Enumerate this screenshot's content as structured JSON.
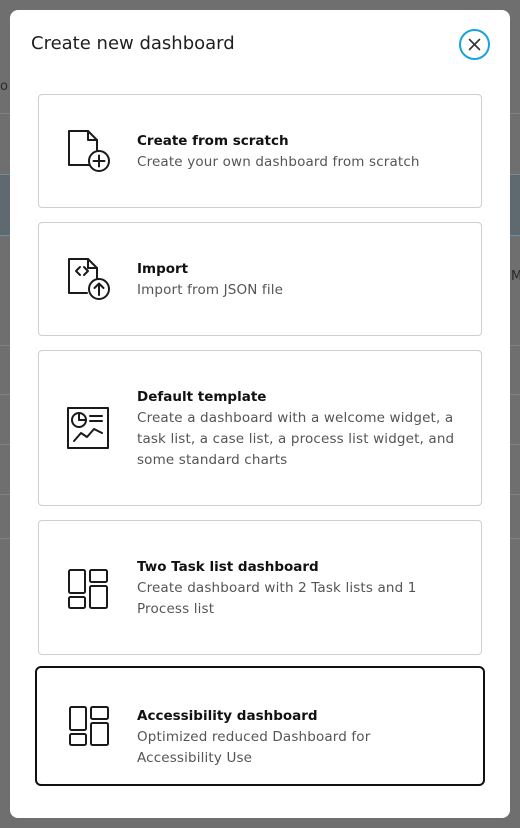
{
  "background": {
    "left_fragment": "o",
    "right_fragment": "M"
  },
  "dialog": {
    "title": "Create new dashboard",
    "close_label": "Close"
  },
  "options": [
    {
      "title": "Create from scratch",
      "description": "Create your own dashboard from scratch",
      "icon": "file-plus-icon"
    },
    {
      "title": "Import",
      "description": "Import from JSON file",
      "icon": "file-import-icon"
    },
    {
      "title": "Default template",
      "description": "Create a dashboard with a welcome widget, a task list, a case list, a process list widget, and some standard charts",
      "icon": "chart-template-icon"
    },
    {
      "title": "Two Task list dashboard",
      "description": "Create dashboard with 2 Task lists and 1 Process list",
      "icon": "layout-icon"
    },
    {
      "title": "Accessibility dashboard",
      "description": "Optimized reduced Dashboard for Accessibility Use",
      "icon": "layout-icon",
      "selected": true
    }
  ],
  "colors": {
    "overlay": "#6f6f6f",
    "close_ring": "#1aa2e0",
    "card_border": "#cfcfcf",
    "selected_border": "#111111"
  }
}
